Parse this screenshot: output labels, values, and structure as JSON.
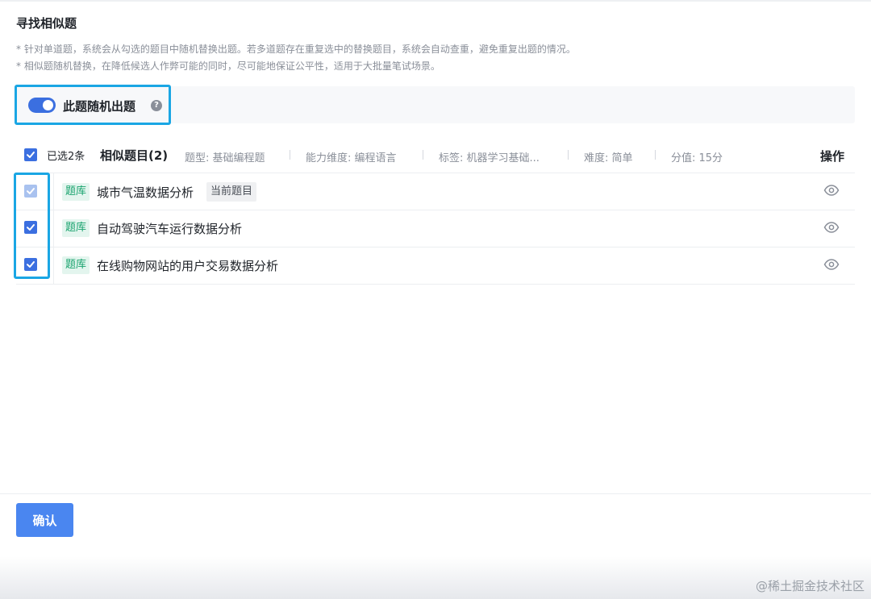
{
  "dialog": {
    "title": "寻找相似题",
    "hints": [
      "* 针对单道题，系统会从勾选的题目中随机替换出题。若多道题存在重复选中的替换题目，系统会自动查重，避免重复出题的情况。",
      "* 相似题随机替换，在降低候选人作弊可能的同时，尽可能地保证公平性，适用于大批量笔试场景。"
    ]
  },
  "toggle": {
    "label": "此题随机出题",
    "enabled": true,
    "help_glyph": "?"
  },
  "list_header": {
    "selected_count": "已选2条",
    "title": "相似题目(2)",
    "type": "题型: 基础编程题",
    "ability": "能力维度: 编程语言",
    "tags": "标签: 机器学习基础...",
    "difficulty": "难度: 简单",
    "score": "分值: 15分",
    "ops": "操作"
  },
  "questions": [
    {
      "source": "题库",
      "title": "城市气温数据分析",
      "badge": "当前题目",
      "checked": true,
      "disabled": true
    },
    {
      "source": "题库",
      "title": "自动驾驶汽车运行数据分析",
      "checked": true,
      "disabled": false
    },
    {
      "source": "题库",
      "title": "在线购物网站的用户交易数据分析",
      "checked": true,
      "disabled": false
    }
  ],
  "footer": {
    "confirm_label": "确认"
  },
  "watermark": "@稀土掘金技术社区",
  "colors": {
    "primary": "#3b6fe0",
    "highlight": "#1aa6e4",
    "tag_bg": "#e3f5ee",
    "tag_text": "#19a36e"
  }
}
